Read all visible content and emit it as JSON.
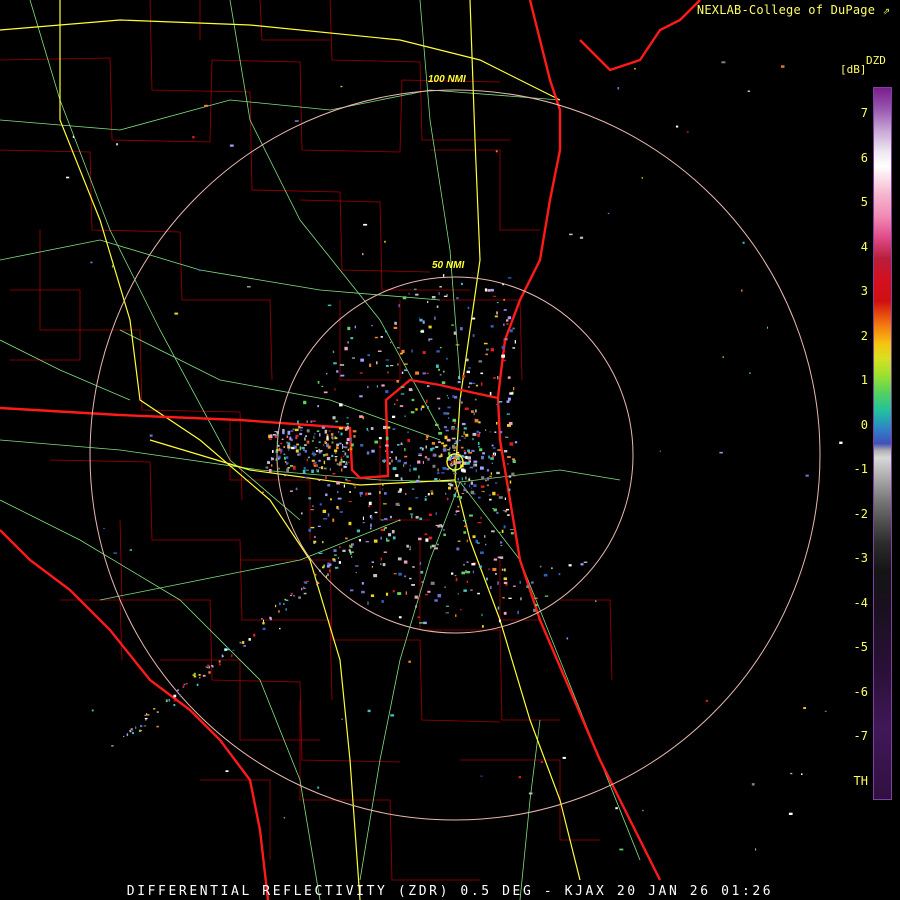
{
  "header": {
    "credit": "NEXLAB-College of DuPage",
    "credit_icon": "external-link-icon"
  },
  "scale": {
    "product": "DZD",
    "units": "[dB]",
    "ticks": [
      "7",
      "6",
      "5",
      "4",
      "3",
      "2",
      "1",
      "0",
      "-1",
      "-2",
      "-3",
      "-4",
      "-5",
      "-6",
      "-7",
      "TH"
    ]
  },
  "rings": {
    "inner_label": "50 NMI",
    "outer_label": "100 NMI"
  },
  "footer": {
    "caption": "DIFFERENTIAL REFLECTIVITY (ZDR) 0.5 DEG - KJAX 20 JAN 26 01:26"
  },
  "colors": {
    "state_lines": "#ff1a1a",
    "county_lines": "#a00000",
    "interstates": "#ffff33",
    "highways": "#80e080",
    "range_rings": "#e8b8b0",
    "text": "#ffff66"
  }
}
